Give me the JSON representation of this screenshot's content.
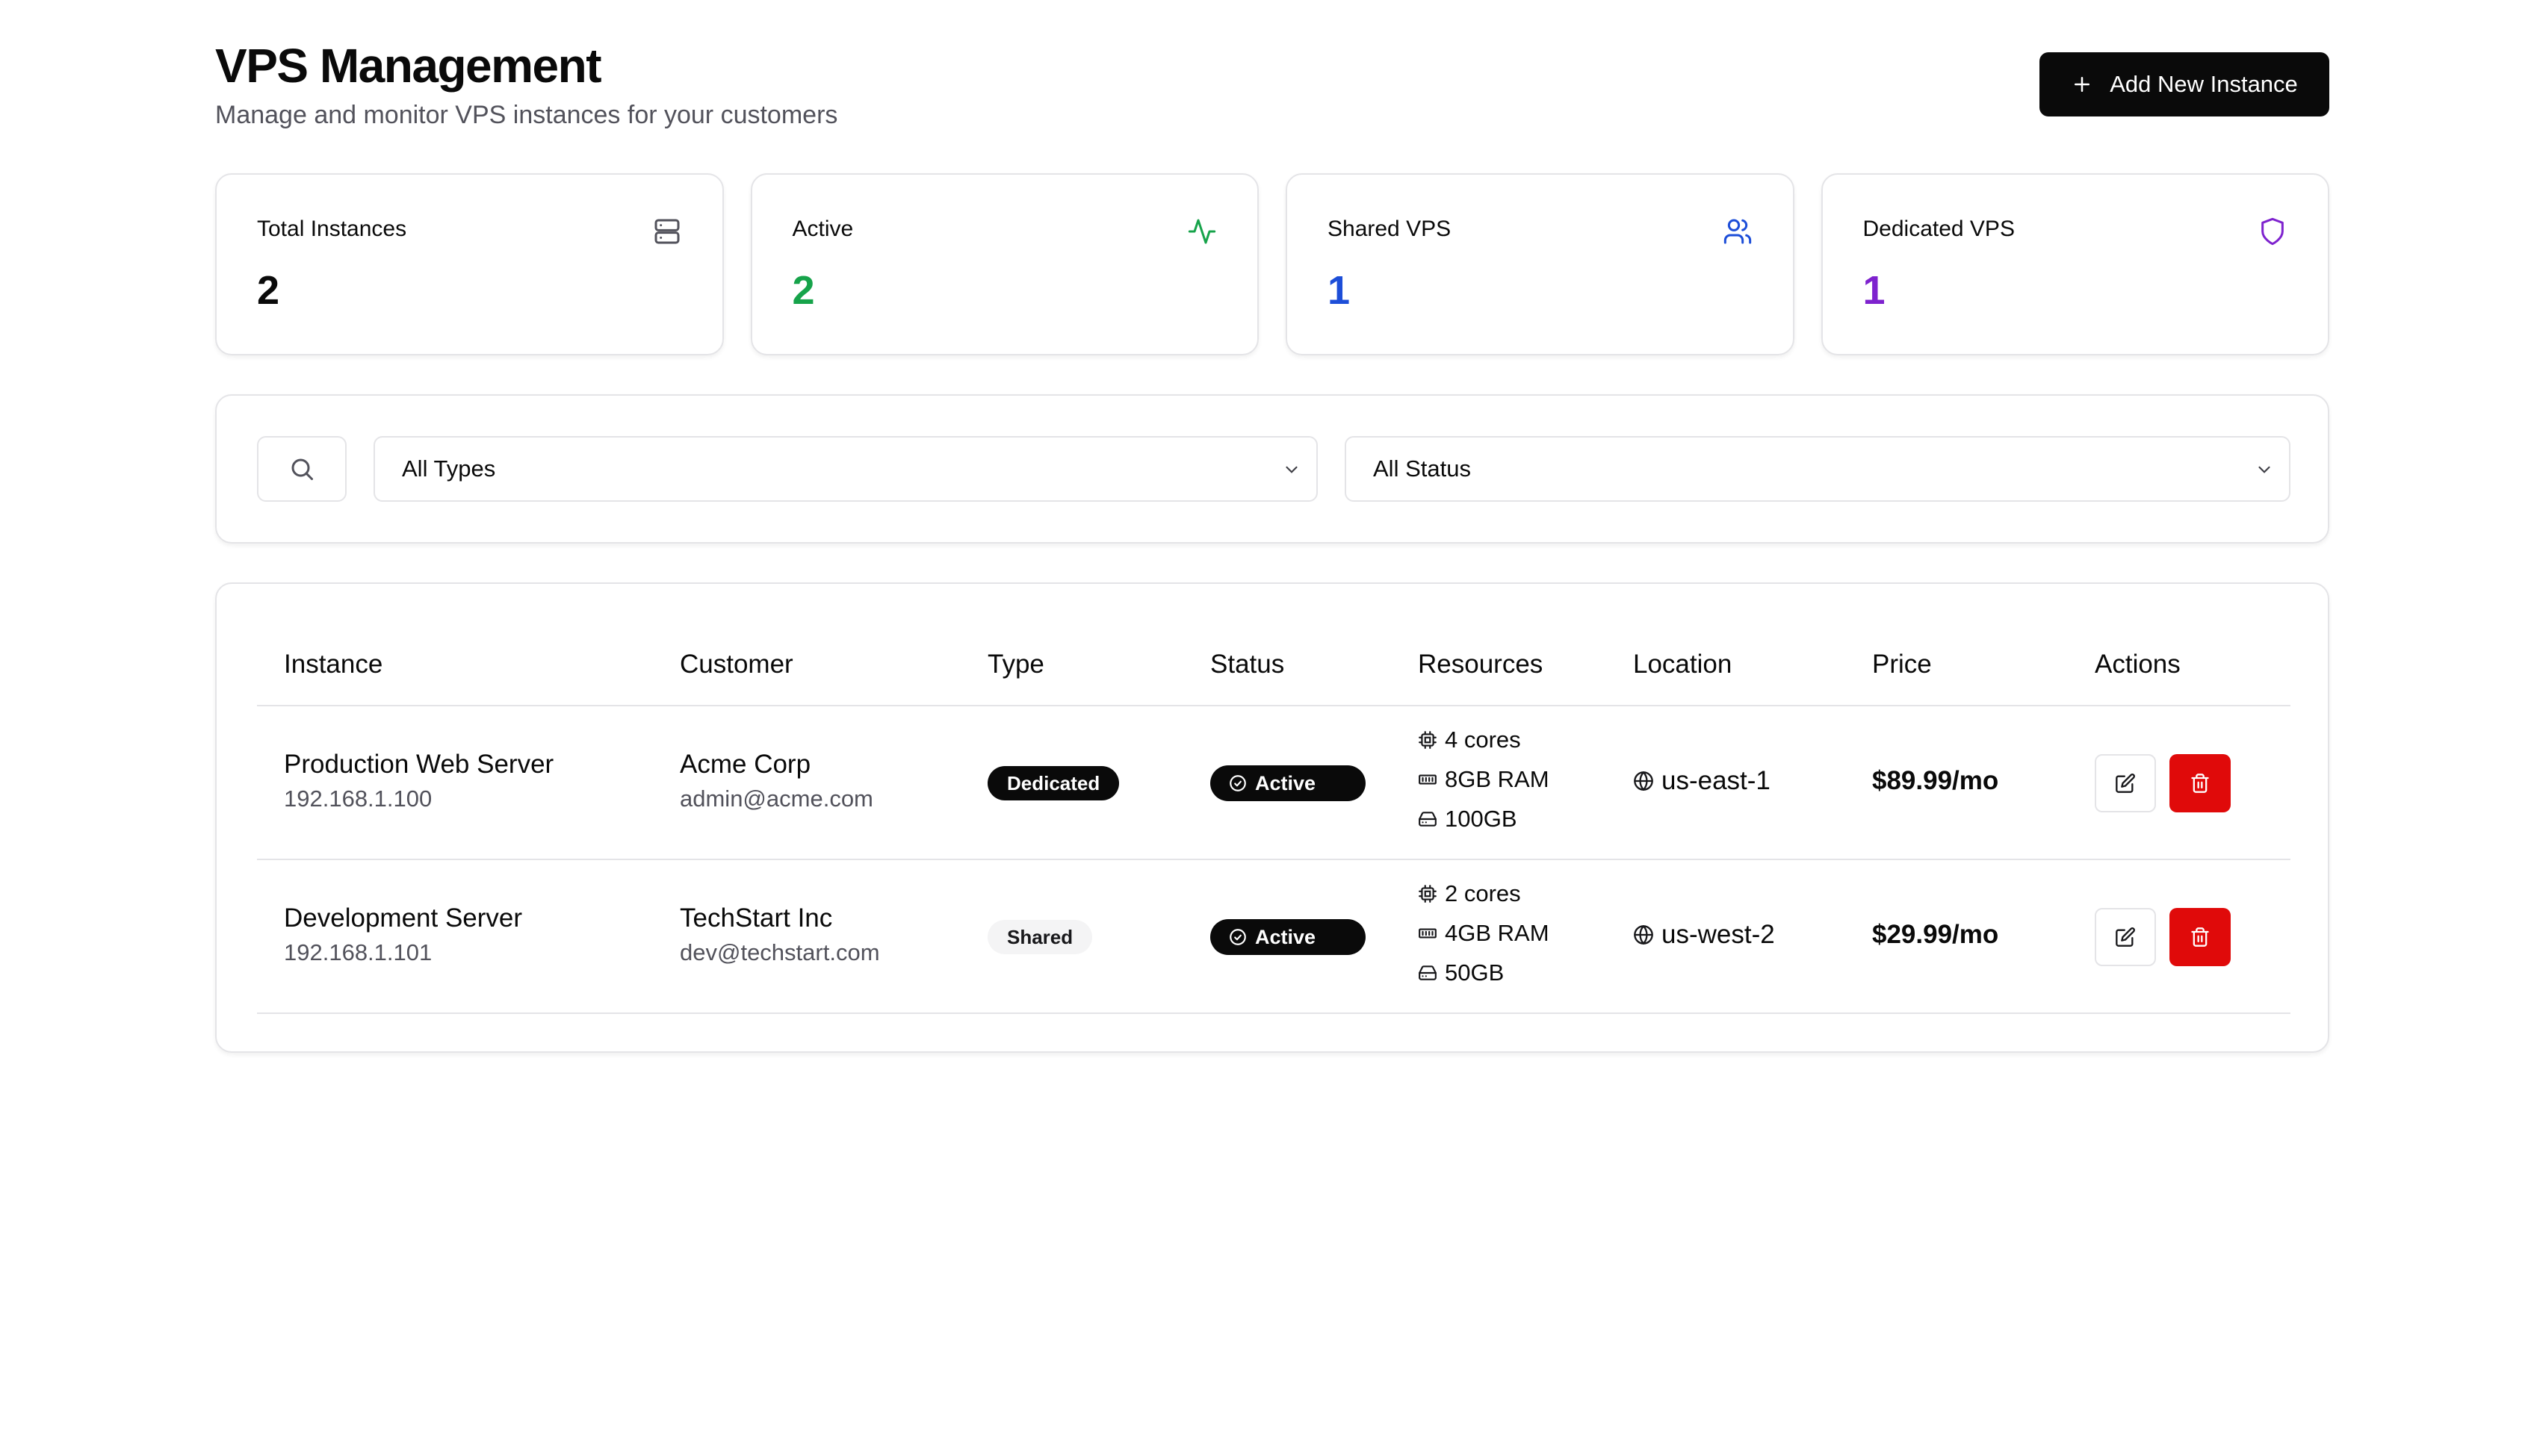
{
  "header": {
    "title": "VPS Management",
    "subtitle": "Manage and monitor VPS instances for your customers",
    "add_button_label": "Add New Instance"
  },
  "stats": [
    {
      "label": "Total Instances",
      "value": "2",
      "icon": "server-icon",
      "color": "#0a0a0a"
    },
    {
      "label": "Active",
      "value": "2",
      "icon": "activity-icon",
      "color": "#16a34a"
    },
    {
      "label": "Shared VPS",
      "value": "1",
      "icon": "users-icon",
      "color": "#1d4ed8"
    },
    {
      "label": "Dedicated VPS",
      "value": "1",
      "icon": "shield-icon",
      "color": "#7e22ce"
    }
  ],
  "filters": {
    "search_placeholder": "",
    "type_selected": "All Types",
    "status_selected": "All Status"
  },
  "table": {
    "columns": [
      "Instance",
      "Customer",
      "Type",
      "Status",
      "Resources",
      "Location",
      "Price",
      "Actions"
    ],
    "rows": [
      {
        "name": "Production Web Server",
        "ip": "192.168.1.100",
        "customer": "Acme Corp",
        "email": "admin@acme.com",
        "type": "Dedicated",
        "status": "Active",
        "cpu": "4 cores",
        "ram": "8GB RAM",
        "disk": "100GB",
        "location": "us-east-1",
        "price": "$89.99/mo"
      },
      {
        "name": "Development Server",
        "ip": "192.168.1.101",
        "customer": "TechStart Inc",
        "email": "dev@techstart.com",
        "type": "Shared",
        "status": "Active",
        "cpu": "2 cores",
        "ram": "4GB RAM",
        "disk": "50GB",
        "location": "us-west-2",
        "price": "$29.99/mo"
      }
    ]
  }
}
